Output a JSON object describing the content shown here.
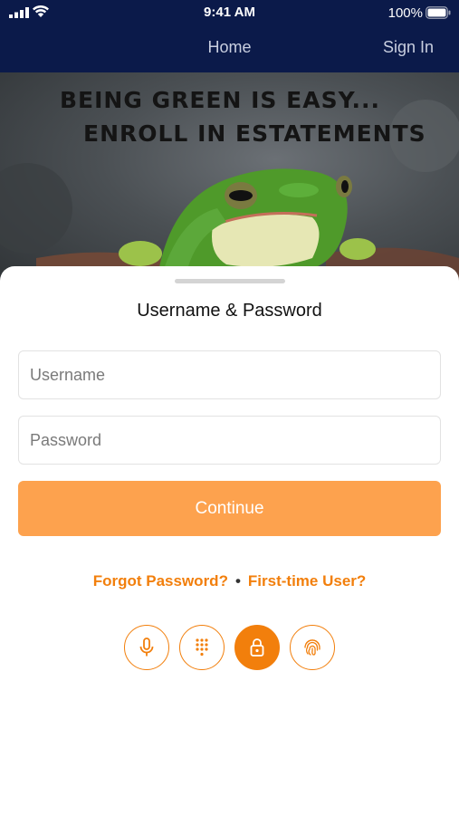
{
  "status_bar": {
    "time": "9:41 AM",
    "battery_percent": "100%"
  },
  "nav": {
    "home_label": "Home",
    "sign_in_label": "Sign In"
  },
  "banner": {
    "line1": "BEING GREEN IS EASY...",
    "line2": "ENROLL IN ESTATEMENTS"
  },
  "login": {
    "title": "Username & Password",
    "username_placeholder": "Username",
    "password_placeholder": "Password",
    "username_value": "",
    "password_value": "",
    "continue_label": "Continue",
    "forgot_password_label": "Forgot Password?",
    "separator": "•",
    "first_time_user_label": "First-time User?"
  },
  "auth_methods": [
    {
      "icon": "microphone-icon",
      "selected": false
    },
    {
      "icon": "keypad-icon",
      "selected": false
    },
    {
      "icon": "lock-icon",
      "selected": true
    },
    {
      "icon": "fingerprint-icon",
      "selected": false
    }
  ],
  "colors": {
    "nav_background": "#0b1a4a",
    "accent_orange": "#f27f0c",
    "continue_button": "#fda24e"
  }
}
